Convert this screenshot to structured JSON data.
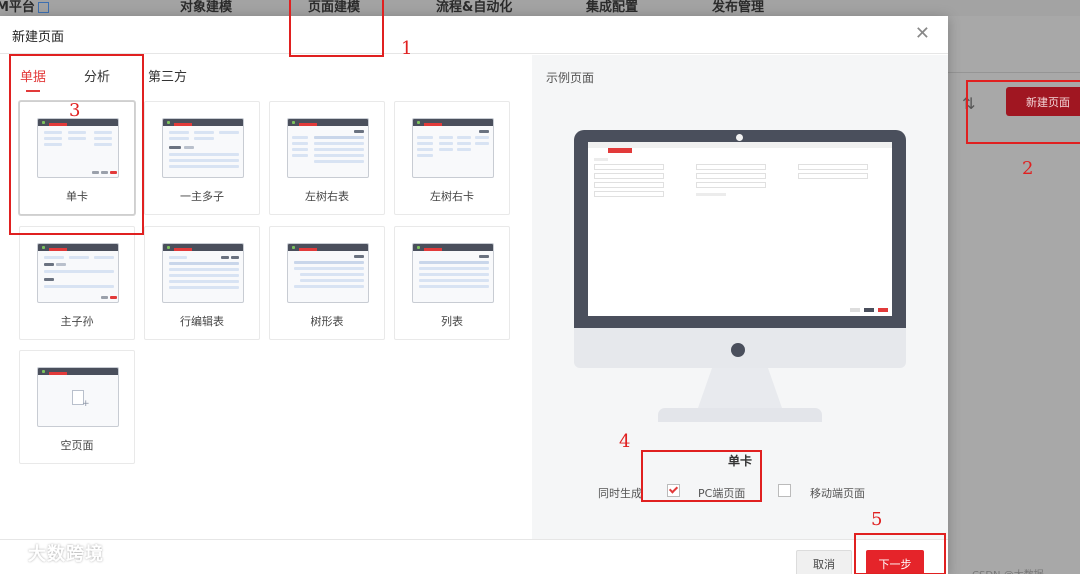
{
  "background": {
    "logo_text": "M平台",
    "nav": [
      "对象建模",
      "页面建模",
      "流程&自动化",
      "集成配置",
      "发布管理"
    ],
    "new_page_button": "新建页面",
    "sort_icon": "sort-arrows-icon",
    "watermark_bottom": "CSDN @大数据"
  },
  "modal": {
    "title": "新建页面",
    "close_icon": "close-icon",
    "tabs": [
      {
        "label": "单据",
        "active": true
      },
      {
        "label": "分析",
        "active": false
      },
      {
        "label": "第三方",
        "active": false
      }
    ],
    "templates": [
      {
        "label": "单卡",
        "selected": true
      },
      {
        "label": "一主多子",
        "selected": false
      },
      {
        "label": "左树右表",
        "selected": false
      },
      {
        "label": "左树右卡",
        "selected": false
      },
      {
        "label": "主子孙",
        "selected": false
      },
      {
        "label": "行编辑表",
        "selected": false
      },
      {
        "label": "树形表",
        "selected": false
      },
      {
        "label": "列表",
        "selected": false
      },
      {
        "label": "空页面",
        "selected": false
      }
    ],
    "preview": {
      "title": "示例页面",
      "name": "单卡",
      "generate_label": "同时生成",
      "options": [
        {
          "label": "PC端页面",
          "checked": true
        },
        {
          "label": "移动端页面",
          "checked": false
        }
      ]
    },
    "footer": {
      "cancel": "取消",
      "next": "下一步"
    }
  },
  "annotations": [
    "1",
    "2",
    "3",
    "4",
    "5"
  ],
  "watermark": "大数跨境",
  "colors": {
    "accent": "#e23a3a",
    "primary_button": "#e5242a",
    "annotation": "#e02020",
    "thumbnail_header": "#4a4f5c"
  }
}
